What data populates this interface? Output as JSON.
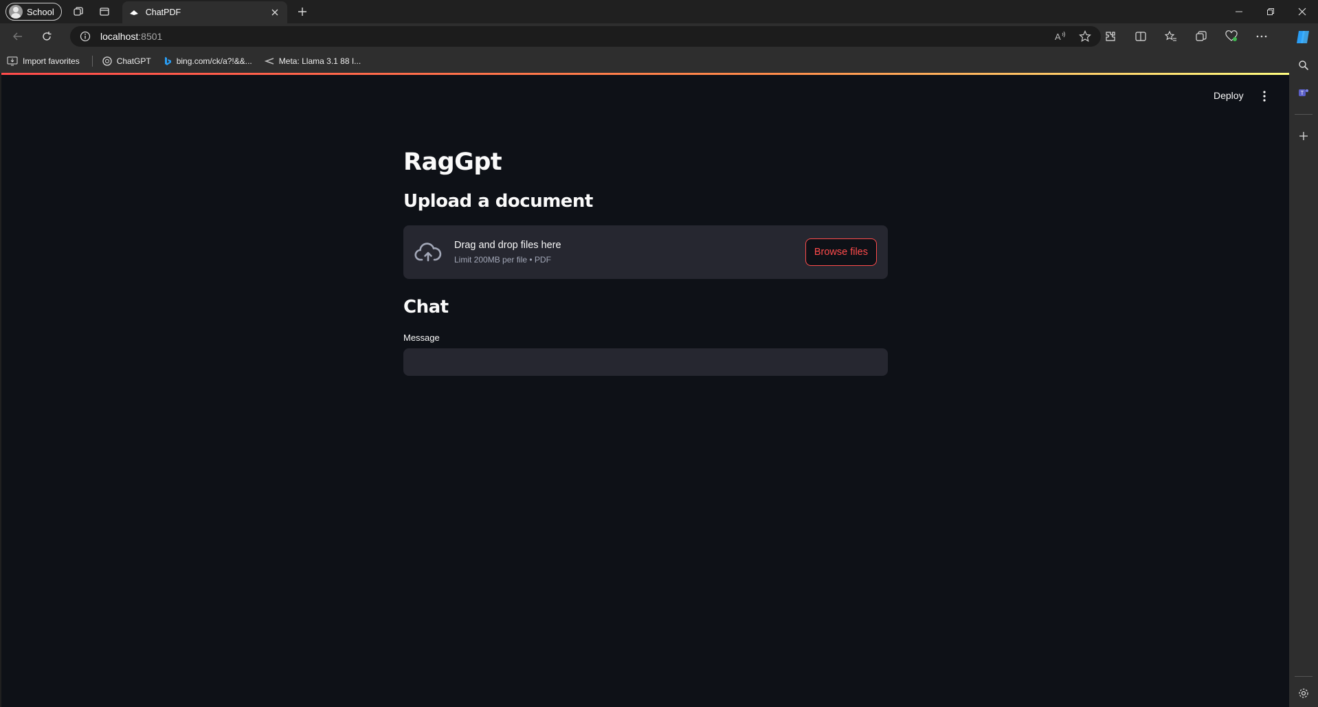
{
  "browser": {
    "profile_label": "School",
    "tab_title": "ChatPDF",
    "url_host": "localhost",
    "url_port": ":8501",
    "bookmarks": [
      {
        "label": "Import favorites",
        "icon": "import-favorites-icon"
      },
      {
        "label": "ChatGPT",
        "icon": "chatgpt-icon"
      },
      {
        "label": "bing.com/ck/a?!&&...",
        "icon": "bing-icon"
      },
      {
        "label": "Meta: Llama 3.1 88 I...",
        "icon": "meta-icon"
      }
    ]
  },
  "app": {
    "deploy_label": "Deploy",
    "title": "RagGpt",
    "upload": {
      "heading": "Upload a document",
      "drop_text": "Drag and drop files here",
      "limit_text": "Limit 200MB per file • PDF",
      "browse_label": "Browse files"
    },
    "chat": {
      "heading": "Chat",
      "message_label": "Message",
      "message_value": ""
    }
  },
  "colors": {
    "accent": "#ff4b4b",
    "app_background": "#0e1117",
    "widget_background": "#262730"
  }
}
